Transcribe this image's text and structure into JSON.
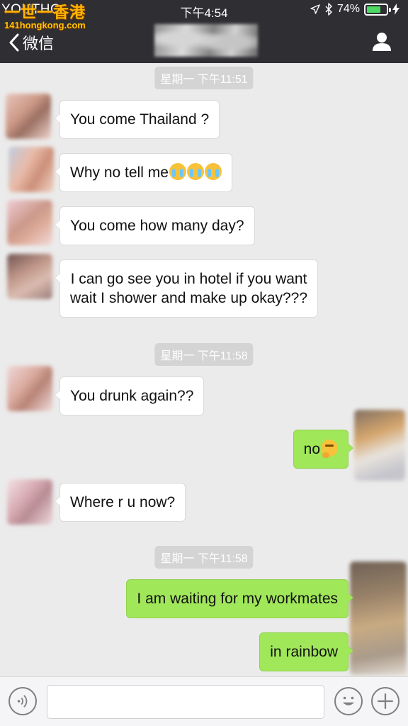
{
  "watermark": {
    "title": "一世一香港",
    "url": "141hongkong.com"
  },
  "status_bar": {
    "carrier": "YOUTHG",
    "time": "下午4:54",
    "battery_percent": "74%",
    "battery_level": 0.74
  },
  "nav": {
    "back_label": "微信"
  },
  "messages": {
    "ts1": "星期一 下午11:51",
    "m1": "You come Thailand ?",
    "m2": "Why no tell me",
    "m3": "You come how many day?",
    "m4_line1": "I can go see you in hotel if you want",
    "m4_line2": "wait I shower and make up okay???",
    "ts2": "星期一 下午11:58",
    "m5": "You drunk again??",
    "m6": "no",
    "m7": "Where r u now?",
    "ts3": "星期一 下午11:58",
    "m8": "I am waiting for my workmates",
    "m9": "in rainbow"
  },
  "icons": {
    "back": "chevron-left-icon",
    "profile": "person-icon",
    "location": "location-arrow-icon",
    "bluetooth": "bluetooth-icon",
    "charging": "charging-bolt-icon",
    "voice": "voice-icon",
    "emoji": "smiley-icon",
    "plus": "plus-icon",
    "crying_emoji": "loudly-crying-face",
    "thinking_emoji": "thinking-face"
  },
  "colors": {
    "nav_bg": "#2f2f33",
    "outgoing_bubble": "#a0e75a",
    "incoming_bubble": "#ffffff",
    "chat_bg": "#ebebeb"
  }
}
